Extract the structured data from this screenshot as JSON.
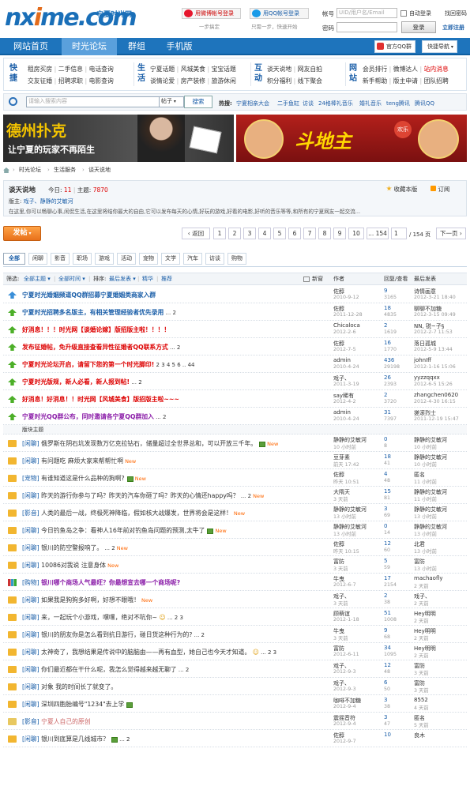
{
  "logo": {
    "brand_a": "nx",
    "brand_b": "i",
    "brand_c": "me",
    "tld": ".com",
    "subtitle": "宁夏时光网"
  },
  "header": {
    "weibo_login": "用微博帐号登录",
    "weibo_tip": "一步搞定",
    "qq_login": "用QQ帐号登录",
    "qq_tip": "只需一步，快速开始",
    "account_label": "帐号",
    "account_placeholder": "UID/用户名/Email",
    "remember": "自动登录",
    "forgot": "找回密码",
    "password_label": "密码",
    "login_btn": "登录",
    "register": "立即注册"
  },
  "nav": {
    "items": [
      "网站首页",
      "时光论坛",
      "群组",
      "手机版"
    ],
    "active": 1,
    "qq_group": "官方QQ群",
    "quick_nav": "快捷导航"
  },
  "quick": {
    "g1_title": "快捷",
    "g1": [
      [
        "租房买房",
        "二手信息",
        "电话查询"
      ],
      [
        "交友征婚",
        "招聘求职",
        "电影查询"
      ]
    ],
    "g2_title": "生活",
    "g2": [
      [
        "宁夏话题",
        "风城美食",
        "宝宝话题"
      ],
      [
        "谈情论爱",
        "房产装修",
        "旅游休闲"
      ]
    ],
    "g3_title": "互动",
    "g3": [
      [
        "谈天说地",
        "网友自拍"
      ],
      [
        "积分福利",
        "线下聚会"
      ]
    ],
    "g4_title": "网站",
    "g4": [
      [
        "会员排行",
        "微博达人",
        "站内消息"
      ],
      [
        "新手帮助",
        "版主申请",
        "团队招聘"
      ]
    ]
  },
  "search": {
    "placeholder": "请输入搜索内容",
    "type": "帖子",
    "btn": "搜索",
    "hot_label": "热搜:",
    "hot": [
      "宁夏相亲大会",
      "二手鱼缸",
      "访谈",
      "24格棒礼音乐",
      "婚礼音乐",
      "teng腾讯",
      "腾讯QQ"
    ]
  },
  "banner_left": {
    "line1": "德州扑克",
    "line2": "让宁夏的玩家不再陌生"
  },
  "banner_right": {
    "line1": "斗地主",
    "tag": "欢乐"
  },
  "breadcrumb": [
    "时光论坛",
    "生活服务",
    "谈天说地"
  ],
  "forum": {
    "name": "谈天说地",
    "today_label": "今日:",
    "today": "11",
    "topics_label": "主题:",
    "topics": "7870",
    "fav": "收藏本版",
    "rss": "订阅",
    "mod_label": "版主:",
    "mods": "戏子、静静的艾敏河",
    "desc": "在这里,你可以畅聊心事,闲侃生活,在这里将结你最大的自由,它可以发布每天的心情,好玩的游戏,好看的电影,好听的音乐等等,和所有的宁夏网友一起交流..."
  },
  "postbar": {
    "post": "发帖",
    "prev": "返回",
    "pages": [
      "1",
      "2",
      "3",
      "4",
      "5",
      "6",
      "7",
      "8",
      "9",
      "10"
    ],
    "last": "154",
    "ellipsis": "... 154",
    "page_input": "1",
    "page_total": "/ 154 页",
    "next": "下一页"
  },
  "tabs": [
    "全部",
    "闲聊",
    "影音",
    "职场",
    "游戏",
    "活动",
    "宠物",
    "文学",
    "汽车",
    "访谈",
    "购物"
  ],
  "thead": {
    "filter": "筛选:",
    "all_topics": "全部主题",
    "all_time": "全部时间",
    "sort": "排序:",
    "latest": "最后发表",
    "hot": "精华",
    "recommend": "推荐",
    "new": "新窗",
    "author": "作者",
    "reply": "回复/查看",
    "lastpost": "最后发表"
  },
  "sticky": [
    {
      "title": "宁夏时光婚姻频道QQ群招募宁夏婚姻类商家入群",
      "color": "#1a5ea8",
      "author": "佐醇",
      "adate": "2010-9-12",
      "rep": "9",
      "view": "3165",
      "lp": "诗情画意",
      "lpd": "2012-3-21 18:40",
      "pages": ""
    },
    {
      "title": "宁夏时光招聘多名版主，有相关管理经验者优先录用",
      "color": "#1a5ea8",
      "author": "佐醇",
      "adate": "2011-12-28",
      "rep": "18",
      "view": "4835",
      "lp": "聊聊不加糖",
      "lpd": "2012-3-15 09:49",
      "pages": " ... 2"
    },
    {
      "title": "好消息！！！时光网【谈婚论嫁】版招版主啦！！！！",
      "color": "#d00",
      "author": "Chicaloca",
      "adate": "2012-2-6",
      "rep": "2",
      "view": "1619",
      "lp": "NN, 锐~子§",
      "lpd": "2012-2-7 11:53",
      "pages": ""
    },
    {
      "title": "发布征婚帖，免升级直接查看异性征婚者QQ联系方式",
      "color": "#d00",
      "author": "佐醇",
      "adate": "2012-7-5",
      "rep": "16",
      "view": "1770",
      "lp": "落日孤城",
      "lpd": "2012-5-9 13:44",
      "pages": " ... 2"
    },
    {
      "title": "宁夏时光论坛开启，请留下您的第一个时光脚印!",
      "color": "#d00",
      "author": "admin",
      "adate": "2010-4-24",
      "rep": "436",
      "view": "29198",
      "lp": "johnIff",
      "lpd": "2012-1-16 15:06",
      "pages": " 2 3 4 5 6 .. 44"
    },
    {
      "title": "宁夏时光版规，新人必看，新人报到帖!",
      "color": "#d00",
      "author": "戏子、",
      "adate": "2011-3-19",
      "rep": "26",
      "view": "2393",
      "lp": "yyzzqqxx",
      "lpd": "2012-6-5 15:26",
      "pages": " ... 2"
    },
    {
      "title": "好消息！好消息！！时光网【风城美食】版招版主啦~~~",
      "color": "#d00",
      "author": "say稀有",
      "adate": "2012-4-2",
      "rep": "2",
      "view": "3720",
      "lp": "zhangchen0620",
      "lpd": "2012-4-30 16:15",
      "pages": ""
    },
    {
      "title": "宁夏时光QQ群公布，同时邀请各宁夏QQ群加入",
      "color": "#8a1ca8",
      "author": "admin",
      "adate": "2010-4-24",
      "rep": "31",
      "view": "7397",
      "lp": "搓滚烈士",
      "lpd": "2011-12-19 15:47",
      "pages": " ... 2"
    }
  ],
  "divider": "版块主题",
  "normal": [
    {
      "cat": "闲聊",
      "title": "俄罗斯在阴石坑发现数万亿克拉钻石，储量超过全世界总和，可以开放三千年。",
      "author": "静静的艾敏河",
      "adate": "10 小时前",
      "rep": "0",
      "view": "8",
      "lp": "静静的艾敏河",
      "lpd": "10 小时前",
      "img": true,
      "new": true,
      "pages": "",
      "c": "#333"
    },
    {
      "cat": "闲聊",
      "title": "有问题吃 麻烦大家来帮帮忙啊",
      "author": "豆芽素",
      "adate": "前天 17:42",
      "rep": "18",
      "view": "41",
      "lp": "静静的艾敏河",
      "lpd": "10 小时前",
      "new": true,
      "pages": "",
      "c": "#333"
    },
    {
      "cat": "宠物",
      "title": "有谁知道这是什么品种的狗啊?",
      "author": "佐醇",
      "adate": "昨天 10:51",
      "rep": "4",
      "view": "48",
      "lp": "匿名",
      "lpd": "11 小时前",
      "img": true,
      "new": true,
      "pages": "",
      "c": "#333"
    },
    {
      "cat": "闲聊",
      "title": "昨天的游行你参与了吗？昨天的汽车你砸了吗？昨天的心情还happy吗？",
      "author": "大隋天",
      "adate": "3 天前",
      "rep": "15",
      "view": "81",
      "lp": "静静的艾敏河",
      "lpd": "11 小时前",
      "new": true,
      "pages": " ... 2",
      "c": "#333"
    },
    {
      "cat": "影音",
      "title": "人类的最后一战，终极死神降临，假如核大战爆发，世界将会是这样！",
      "author": "静静的艾敏河",
      "adate": "13 小时前",
      "rep": "3",
      "view": "69",
      "lp": "静静的艾敏河",
      "lpd": "13 小时前",
      "new": true,
      "pages": "",
      "c": "#333"
    },
    {
      "cat": "闲聊",
      "title": "今日钓鱼岛之争：看神人16年前对钓鱼岛问题的预测,太牛了",
      "author": "静静的艾敏河",
      "adate": "13 小时前",
      "rep": "0",
      "view": "14",
      "lp": "静静的艾敏河",
      "lpd": "13 小时前",
      "img": true,
      "new": true,
      "pages": "",
      "c": "#333"
    },
    {
      "cat": "闲聊",
      "title": "银川的防空警报响了。",
      "author": "佐醇",
      "adate": "昨天 10:15",
      "rep": "12",
      "view": "60",
      "lp": "北君",
      "lpd": "13 小时前",
      "new": true,
      "pages": " ... 2",
      "c": "#333"
    },
    {
      "cat": "闲聊",
      "title": "10086对我说 注意身体",
      "author": "富防",
      "adate": "3 天前",
      "rep": "5",
      "view": "59",
      "lp": "富防",
      "lpd": "13 小时前",
      "new": true,
      "pages": "",
      "c": "#333"
    },
    {
      "cat": "购物",
      "title": "银川哪个商场人气最旺？你最想宣去哪一个商场呢?",
      "author": "牛曳",
      "adate": "2012-6-7",
      "rep": "17",
      "view": "2154",
      "lp": "machaofly",
      "lpd": "2 天前",
      "pages": "",
      "c": "#8a1ca8",
      "bold": true,
      "poll": true
    },
    {
      "cat": "闲聊",
      "title": "如果我是狗狗多好啊，好想不眼哦！",
      "author": "戏子、",
      "adate": "3 天前",
      "rep": "2",
      "view": "38",
      "lp": "戏子、",
      "lpd": "2 天前",
      "new": true,
      "pages": "",
      "c": "#333"
    },
    {
      "cat": "闲聊",
      "title": "来，一起玩个小游戏，嘿嘿，绝对不吭你~",
      "author": "顾萌谊",
      "adate": "2012-1-18",
      "rep": "51",
      "view": "1008",
      "lp": "Hey明明",
      "lpd": "2 天前",
      "emo": true,
      "pages": " ... 2 3",
      "c": "#333"
    },
    {
      "cat": "闲聊",
      "title": "银川的朋友你是怎么看到抗日游行，碰日货这种行为的?",
      "author": "牛曳",
      "adate": "3 天前",
      "rep": "9",
      "view": "68",
      "lp": "Hey明明",
      "lpd": "2 天前",
      "pages": " ... 2",
      "c": "#333"
    },
    {
      "cat": "闲聊",
      "title": "太神奇了，我想结果是传说中的脑脑由——再有血型，她自己也今天才知道。",
      "author": "富防",
      "adate": "2012-6-11",
      "rep": "34",
      "view": "1095",
      "lp": "Hey明明",
      "lpd": "2 天前",
      "emo": true,
      "pages": " ... 2 3",
      "c": "#333"
    },
    {
      "cat": "闲聊",
      "title": "你们最近都在干什么呢，我怎么觉得越来越无聊了",
      "author": "戏子、",
      "adate": "2012-9-3",
      "rep": "12",
      "view": "48",
      "lp": "富防",
      "lpd": "3 天前",
      "pages": " ... 2",
      "c": "#333"
    },
    {
      "cat": "闲聊",
      "title": "对象 我的时间长了就变了。",
      "author": "戏子、",
      "adate": "2012-9-3",
      "rep": "6",
      "view": "50",
      "lp": "富防",
      "lpd": "3 天前",
      "pages": "",
      "c": "#333"
    },
    {
      "cat": "闲聊",
      "title": "深圳四胞胎编号\"1234\"去上学",
      "author": "咖啡不加糖",
      "adate": "2012-9-4",
      "rep": "3",
      "view": "38",
      "lp": "8552",
      "lpd": "4 天前",
      "img": true,
      "pages": "",
      "c": "#333"
    },
    {
      "cat": "影音",
      "title": "宁夏人自己的原创",
      "author": "震摇音符",
      "adate": "2012-9-4",
      "rep": "3",
      "view": "47",
      "lp": "匿名",
      "lpd": "5 天前",
      "pages": "",
      "c": "#c66",
      "bold": false,
      "mute": true
    },
    {
      "cat": "闲聊",
      "title": "银川到底算是几线城市？",
      "author": "佐醇",
      "adate": "2012-9-7",
      "rep": "10",
      "view": "",
      "lp": "良木",
      "lpd": "",
      "img": true,
      "pages": " ... 2",
      "c": "#333"
    }
  ]
}
